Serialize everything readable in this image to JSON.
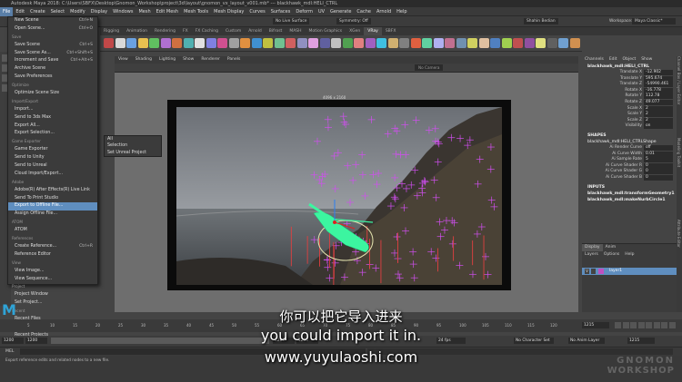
{
  "window": {
    "title": "Autodesk Maya 2018: C:\\Users\\SBFX\\Desktop\\Gnomon_Workshop\\project\\3d\\layout\\gnomon_vx_layout_v001.mb* --- blackhawk_mdl:HELI_CTRL"
  },
  "menubar": [
    "File",
    "Edit",
    "Create",
    "Select",
    "Modify",
    "Display",
    "Windows",
    "Mesh",
    "Edit Mesh",
    "Mesh Tools",
    "Mesh Display",
    "Curves",
    "Surfaces",
    "Deform",
    "UV",
    "Generate",
    "Cache",
    "Arnold",
    "Help"
  ],
  "statusline": {
    "workspace_label": "Workspace:",
    "workspace_value": "Maya Classic*",
    "live_surface": "No Live Surface",
    "symmetry": "Symmetry: Off",
    "user": "Shahin Bedian"
  },
  "shelf_tabs": [
    "Rigging",
    "Animation",
    "Rendering",
    "FX",
    "FX Caching",
    "Custom",
    "Arnold",
    "Bifrost",
    "MASH",
    "Motion Graphics",
    "XGen",
    "VRay",
    "SBFX"
  ],
  "panel_menu": [
    "View",
    "Shading",
    "Lighting",
    "Show",
    "Renderer",
    "Panels"
  ],
  "viewport": {
    "resolution": "4096 x 2160",
    "camera_label": "No Camera"
  },
  "file_menu": [
    {
      "type": "item",
      "label": "New Scene",
      "shortcut": "Ctrl+N"
    },
    {
      "type": "item",
      "label": "Open Scene...",
      "shortcut": "Ctrl+O"
    },
    {
      "type": "section",
      "label": "Save"
    },
    {
      "type": "item",
      "label": "Save Scene",
      "shortcut": "Ctrl+S"
    },
    {
      "type": "item",
      "label": "Save Scene As...",
      "shortcut": "Ctrl+Shift+S"
    },
    {
      "type": "item",
      "label": "Increment and Save",
      "shortcut": "Ctrl+Alt+S"
    },
    {
      "type": "item",
      "label": "Archive Scene",
      "shortcut": ""
    },
    {
      "type": "item",
      "label": "Save Preferences",
      "shortcut": ""
    },
    {
      "type": "section",
      "label": "Optimize"
    },
    {
      "type": "item",
      "label": "Optimize Scene Size",
      "shortcut": ""
    },
    {
      "type": "section",
      "label": "Import/Export"
    },
    {
      "type": "item",
      "label": "Import...",
      "shortcut": ""
    },
    {
      "type": "item",
      "label": "Send to 3ds Max",
      "shortcut": ""
    },
    {
      "type": "item",
      "label": "Export All...",
      "shortcut": ""
    },
    {
      "type": "item",
      "label": "Export Selection...",
      "shortcut": ""
    },
    {
      "type": "section",
      "label": "Game Exporter"
    },
    {
      "type": "item",
      "label": "Game Exporter",
      "shortcut": ""
    },
    {
      "type": "item",
      "label": "Send to Unity",
      "shortcut": ""
    },
    {
      "type": "item",
      "label": "Send to Unreal",
      "shortcut": ""
    },
    {
      "type": "item",
      "label": "Cloud Import/Export...",
      "shortcut": ""
    },
    {
      "type": "section",
      "label": "Adobe"
    },
    {
      "type": "item",
      "label": "Adobe(R) After Effects(R) Live Link",
      "shortcut": ""
    },
    {
      "type": "item",
      "label": "Send To Print Studio",
      "shortcut": ""
    },
    {
      "type": "item",
      "label": "Export to Offline File...",
      "shortcut": "",
      "highlight": true
    },
    {
      "type": "item",
      "label": "Assign Offline File...",
      "shortcut": ""
    },
    {
      "type": "section",
      "label": "ATOM"
    },
    {
      "type": "item",
      "label": "ATOM",
      "shortcut": ""
    },
    {
      "type": "section",
      "label": "References"
    },
    {
      "type": "item",
      "label": "Create Reference...",
      "shortcut": "Ctrl+R"
    },
    {
      "type": "item",
      "label": "Reference Editor",
      "shortcut": ""
    },
    {
      "type": "section",
      "label": "View"
    },
    {
      "type": "item",
      "label": "View Image...",
      "shortcut": ""
    },
    {
      "type": "item",
      "label": "View Sequence...",
      "shortcut": ""
    },
    {
      "type": "section",
      "label": "Project"
    },
    {
      "type": "item",
      "label": "Project Window",
      "shortcut": ""
    },
    {
      "type": "item",
      "label": "Set Project...",
      "shortcut": ""
    },
    {
      "type": "section",
      "label": "Recent"
    },
    {
      "type": "item",
      "label": "Recent Files",
      "shortcut": ""
    },
    {
      "type": "item",
      "label": "Recent Increments",
      "shortcut": "",
      "disabled": true
    },
    {
      "type": "item",
      "label": "Recent Projects",
      "shortcut": ""
    },
    {
      "type": "section",
      "label": ""
    },
    {
      "type": "item",
      "label": "Exit",
      "shortcut": "Ctrl+Q"
    }
  ],
  "submenu": [
    "All",
    "Selection",
    "Set Unreal Project"
  ],
  "channel_box": {
    "tabs": [
      "Channels",
      "Edit",
      "Object",
      "Show"
    ],
    "object": "blackhawk_mdl:HELI_CTRL",
    "channels": [
      {
        "name": "Translate X",
        "value": "-12.902"
      },
      {
        "name": "Translate Y",
        "value": "595.674"
      },
      {
        "name": "Translate Z",
        "value": "-54990.461"
      },
      {
        "name": "Rotate X",
        "value": "-16.778"
      },
      {
        "name": "Rotate Y",
        "value": "112.78"
      },
      {
        "name": "Rotate Z",
        "value": "49.077"
      },
      {
        "name": "Scale X",
        "value": "2"
      },
      {
        "name": "Scale Y",
        "value": "2"
      },
      {
        "name": "Scale Z",
        "value": "2"
      },
      {
        "name": "Visibility",
        "value": "on"
      }
    ],
    "shapes_label": "SHAPES",
    "shape_name": "blackhawk_mdl:HELI_CTRLShape",
    "shape_channels": [
      {
        "name": "Ai Render Curve",
        "value": "off"
      },
      {
        "name": "Ai Curve Width",
        "value": "0.01"
      },
      {
        "name": "Ai Sample Rate",
        "value": "5"
      },
      {
        "name": "Ai Curve Shader R",
        "value": "0"
      },
      {
        "name": "Ai Curve Shader G",
        "value": "0"
      },
      {
        "name": "Ai Curve Shader B",
        "value": "0"
      }
    ],
    "inputs_label": "INPUTS",
    "inputs": [
      "blackhawk_mdl:transformGeometry1",
      "blackhawk_mdl:makeNurbCircle1"
    ]
  },
  "layer_panel": {
    "tabs": [
      "Display",
      "Anim"
    ],
    "menu": [
      "Layers",
      "Options",
      "Help"
    ],
    "layer": "layer1"
  },
  "side_tabs": [
    "Channel Box / Layer Editor",
    "Modeling Toolkit",
    "Attribute Editor"
  ],
  "timeline": {
    "ticks": [
      "5",
      "10",
      "15",
      "20",
      "25",
      "30",
      "35",
      "40",
      "45",
      "50",
      "55",
      "60",
      "65",
      "70",
      "75",
      "80",
      "85",
      "90",
      "95",
      "100",
      "105",
      "110",
      "115",
      "120"
    ],
    "current_frame": "1215",
    "range_start": "1200",
    "range_inner_start": "1200",
    "range_inner_end": "1200",
    "range_end": "1200",
    "fps": "24 fps",
    "character_set": "No Character Set",
    "anim_layer": "No Anim Layer",
    "right_frame": "1215"
  },
  "cmdline": {
    "label": "MEL"
  },
  "helpline": {
    "text": "Export reference edits and related nodes to a new file."
  },
  "subtitles": {
    "chinese": "你可以把它导入进来",
    "english": "you could import it in.",
    "url": "www.yuyulaoshi.com"
  },
  "watermark": {
    "line1": "GNOMON",
    "line2": "WORKSHOP"
  },
  "colors": {
    "highlight": "#5f8ebf",
    "heli": "#3cf5a0",
    "markers": "#d14ff0"
  }
}
